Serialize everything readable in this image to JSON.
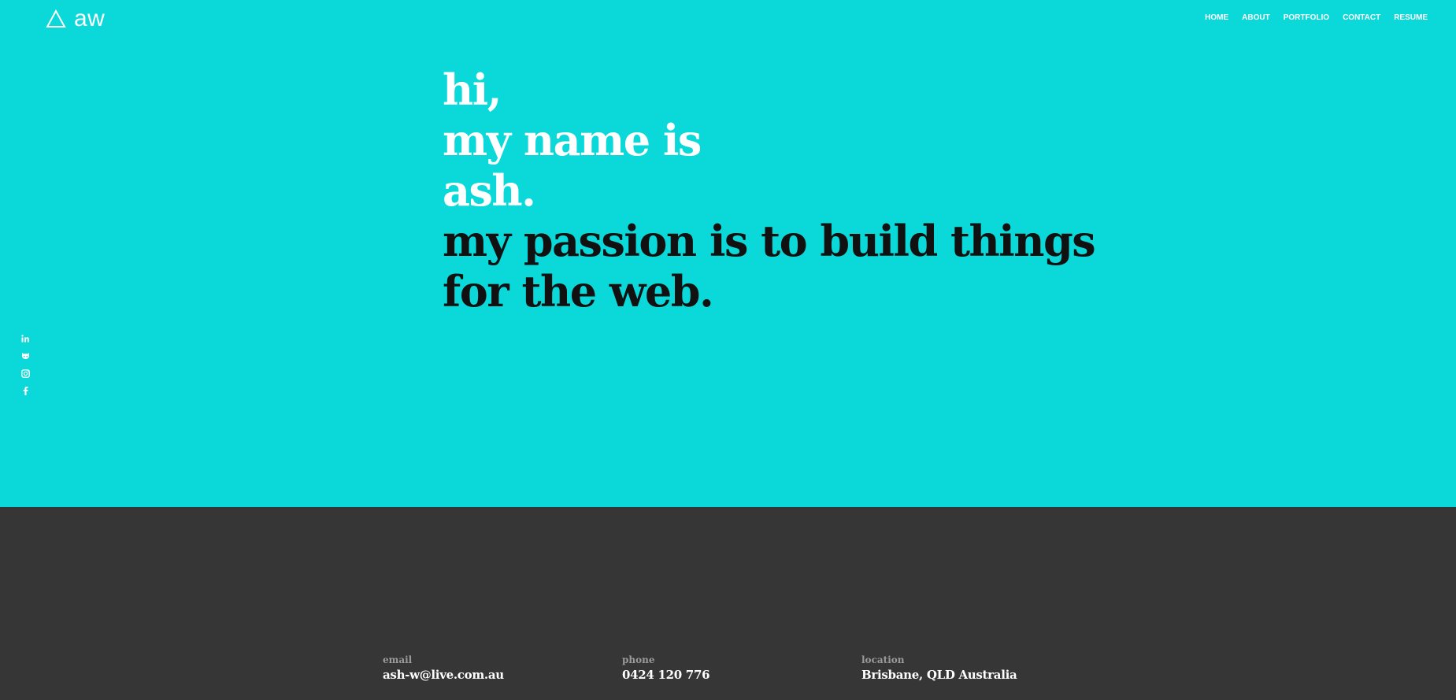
{
  "brand": {
    "logo_text": "aw",
    "logo_icon": "triangle-icon"
  },
  "nav": {
    "items": [
      {
        "label": "HOME"
      },
      {
        "label": "ABOUT"
      },
      {
        "label": "PORTFOLIO"
      },
      {
        "label": "CONTACT"
      },
      {
        "label": "RESUME"
      }
    ]
  },
  "hero": {
    "lines": [
      {
        "text": "hi,"
      },
      {
        "text": "my name is"
      },
      {
        "text": "ash."
      },
      {
        "text": "my passion is to build things"
      },
      {
        "text": "for the web."
      }
    ],
    "colors": {
      "background": "#0bd9d9",
      "light": "#ffffff",
      "dark": "#111111"
    }
  },
  "social": {
    "icons": [
      "linkedin-icon",
      "github-icon",
      "instagram-icon",
      "facebook-icon"
    ]
  },
  "contact": {
    "email": {
      "label": "email",
      "value": "ash-w@live.com.au"
    },
    "phone": {
      "label": "phone",
      "value": "0424 120 776"
    },
    "location": {
      "label": "location",
      "value": "Brisbane, QLD Australia"
    },
    "background": "#363636"
  }
}
